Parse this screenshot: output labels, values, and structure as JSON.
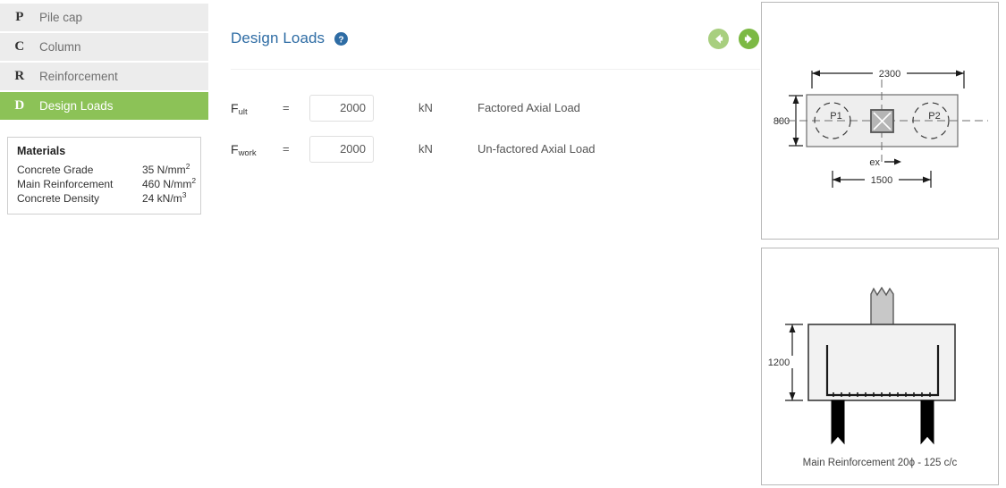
{
  "sidebar": {
    "items": [
      {
        "letter": "P",
        "label": "Pile cap",
        "active": false
      },
      {
        "letter": "C",
        "label": "Column",
        "active": false
      },
      {
        "letter": "R",
        "label": "Reinforcement",
        "active": false
      },
      {
        "letter": "D",
        "label": "Design Loads",
        "active": true
      }
    ],
    "materials": {
      "title": "Materials",
      "rows": [
        {
          "name": "Concrete Grade",
          "value": "35 N/mm",
          "sup": "2"
        },
        {
          "name": "Main Reinforcement",
          "value": "460 N/mm",
          "sup": "2"
        },
        {
          "name": "Concrete Density",
          "value": "24 kN/m",
          "sup": "3"
        }
      ]
    }
  },
  "panel": {
    "title": "Design Loads",
    "help_icon": "help-circle-icon",
    "prev_icon": "arrow-left-circle-icon",
    "next_icon": "arrow-right-circle-icon",
    "accent_green": "#8cc257",
    "accent_green_light": "#a8cf7f",
    "title_blue": "#2e6ca4",
    "fields": [
      {
        "symbol": "F",
        "subscript": "ult",
        "equals": "=",
        "value": "2000",
        "placeholder": "",
        "unit": "kN",
        "description": "Factored Axial Load"
      },
      {
        "symbol": "F",
        "subscript": "work",
        "equals": "=",
        "value": "2000",
        "placeholder": "",
        "unit": "kN",
        "description": "Un-factored Axial Load"
      }
    ]
  },
  "drawings": {
    "plan": {
      "name": "pile-cap-plan-view",
      "width_dim": "2300",
      "depth_dim": "800",
      "spacing_dim": "1500",
      "pile_labels": [
        "P1",
        "P2"
      ],
      "eccentricity_label": "ex"
    },
    "section": {
      "name": "pile-cap-section-view",
      "height_dim": "1200",
      "caption": "Main Reinforcement 20ϕ - 125 c/c"
    }
  }
}
